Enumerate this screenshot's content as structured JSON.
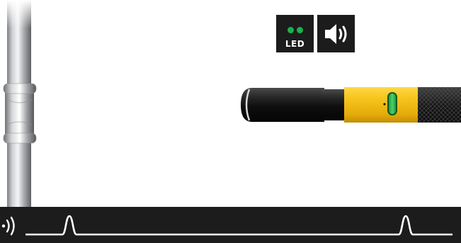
{
  "indicators": {
    "led": {
      "label": "LED",
      "icon": "led-dots-icon",
      "dot_color": "#19b24b",
      "lit": true
    },
    "sound": {
      "icon": "speaker-icon",
      "active": true
    }
  },
  "pipe": {
    "icon": "pipe-with-press-fitting"
  },
  "probe": {
    "icon": "detector-probe",
    "body_color": "#f4c01a",
    "indicator_color": "#26b54a"
  },
  "signal": {
    "icon": "sound-wave-icon",
    "background": "#1c1c1c",
    "line_color": "#ffffff",
    "pulse_count": 2
  }
}
